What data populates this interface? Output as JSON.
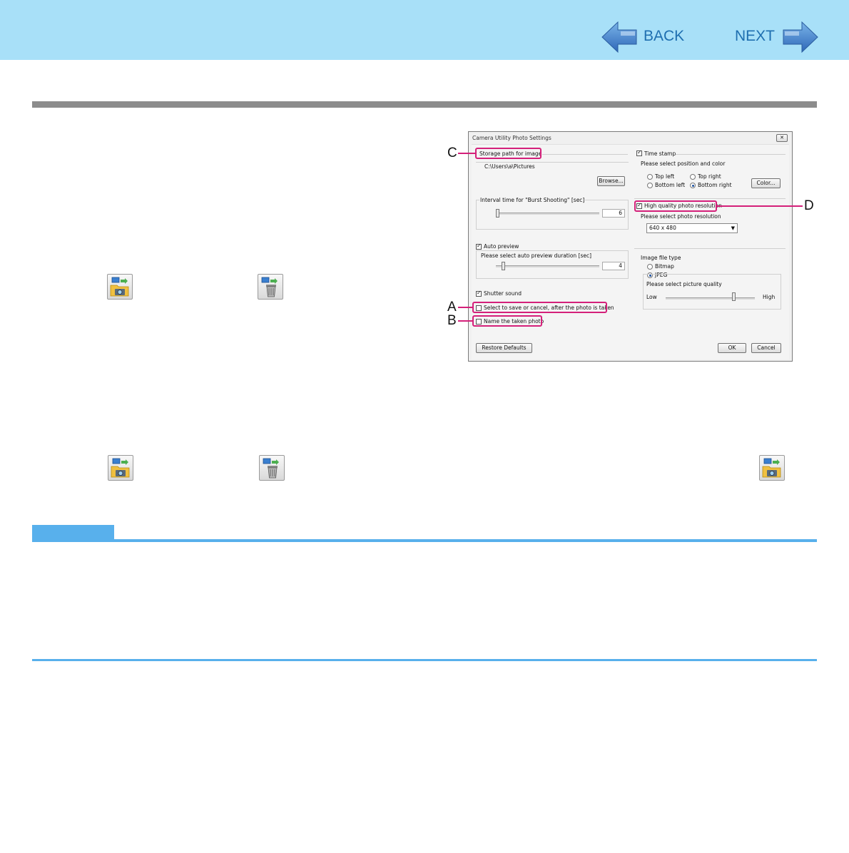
{
  "nav": {
    "back_label": "BACK",
    "next_label": "NEXT"
  },
  "icons": {
    "save_icon": "folder-camera-icon",
    "delete_icon": "trash-camera-icon"
  },
  "dialog": {
    "title": "Camera Utility Photo Settings",
    "close_glyph": "✕",
    "storage": {
      "label": "Storage path for image",
      "path": "C:\\Users\\a\\Pictures",
      "browse_label": "Browse..."
    },
    "interval": {
      "label": "Interval time for \"Burst Shooting\" [sec]",
      "value": "6",
      "slider_fraction": 0.0
    },
    "auto_preview": {
      "label": "Auto preview",
      "checked": true,
      "duration_label": "Please select auto preview duration [sec]",
      "value": "4",
      "slider_fraction": 0.07
    },
    "shutter_sound": {
      "label": "Shutter sound",
      "checked": true
    },
    "select_save": {
      "label": "Select to save or cancel, after the photo is taken",
      "checked": false
    },
    "name_photo": {
      "label": "Name the taken photo",
      "checked": false
    },
    "restore_label": "Restore Defaults",
    "time_stamp": {
      "label": "Time stamp",
      "checked": true,
      "position_label": "Please select position and color",
      "options": [
        {
          "label": "Top left",
          "selected": false
        },
        {
          "label": "Top right",
          "selected": false
        },
        {
          "label": "Bottom left",
          "selected": false
        },
        {
          "label": "Bottom right",
          "selected": true
        }
      ],
      "color_label": "Color..."
    },
    "hq_resolution": {
      "label": "High quality photo resolution",
      "checked": true,
      "select_label": "Please select photo resolution",
      "value": "640 x 480"
    },
    "file_type": {
      "label": "Image file type",
      "options": [
        {
          "label": "Bitmap",
          "selected": false
        },
        {
          "label": "JPEG",
          "selected": true
        }
      ],
      "quality_label": "Please select picture quality",
      "low_label": "Low",
      "high_label": "High",
      "slider_fraction": 0.85
    },
    "ok_label": "OK",
    "cancel_label": "Cancel"
  },
  "callouts": {
    "a": "A",
    "b": "B",
    "c": "C",
    "d": "D"
  },
  "colors": {
    "header_bg": "#a8e0f8",
    "accent": "#58b0ec",
    "highlight": "#d4207a",
    "rule": "#8c8c8c"
  }
}
